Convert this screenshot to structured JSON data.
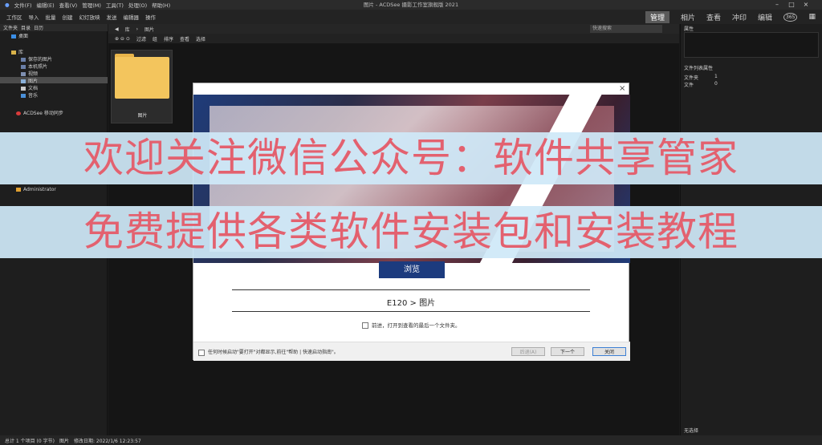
{
  "app": {
    "title": "图片 - ACDSee 摄影工作室旗舰版 2021"
  },
  "menu": [
    "文件(F)",
    "编辑(E)",
    "查看(V)",
    "管理(M)",
    "工具(T)",
    "处理(O)",
    "帮助(H)"
  ],
  "toolbar": {
    "items": [
      "工作区",
      "导入",
      "批量",
      "创建",
      "幻灯放映",
      "发送",
      "编辑器",
      "操作"
    ],
    "modes": [
      "管理",
      "相片",
      "查看",
      "冲印",
      "编辑"
    ],
    "badge": "365"
  },
  "left_panel": {
    "tabs": [
      "文件夹",
      "目录",
      "日历"
    ],
    "tree": [
      {
        "label": "桌面"
      },
      {
        "label": "库"
      },
      {
        "label": "保存的图片"
      },
      {
        "label": "本机照片"
      },
      {
        "label": "视频"
      },
      {
        "label": "图片"
      },
      {
        "label": "文档"
      },
      {
        "label": "音乐"
      },
      {
        "label": "ACDSee 移动同步"
      },
      {
        "label": "Administrator"
      }
    ]
  },
  "browse": {
    "breadcrumb": [
      "库",
      "图片"
    ],
    "search_placeholder": "快速搜索",
    "filters": [
      "过滤",
      "组",
      "排序",
      "查看",
      "选择"
    ],
    "folder_label": "图片"
  },
  "right_panel": {
    "title": "属性",
    "section": "文件列表属性",
    "rows": [
      {
        "label": "文件夹",
        "value": "1"
      },
      {
        "label": "文件",
        "value": "0"
      }
    ],
    "bottom": "无选择"
  },
  "dialog": {
    "close": "×",
    "browse_button": "浏览",
    "path": "E120 > 图片",
    "checkbox_label": "前进，打开到查看的最后一个文件夹。",
    "footer_text": "任何时候启动\"要打开\"对都显示,前往\"帮助 | 快速启动指南\"。",
    "buttons": {
      "back": "后退(A)",
      "next": "下一个",
      "close": "关闭"
    }
  },
  "statusbar": {
    "total": "总计 1 个项目 (0 字节)",
    "item": "图片",
    "modified": "修改日期: 2022/1/6 12:23:57"
  },
  "overlay": {
    "line1": "欢迎关注微信公众号：软件共享管家",
    "line2": "免费提供各类软件安装包和安装教程"
  }
}
